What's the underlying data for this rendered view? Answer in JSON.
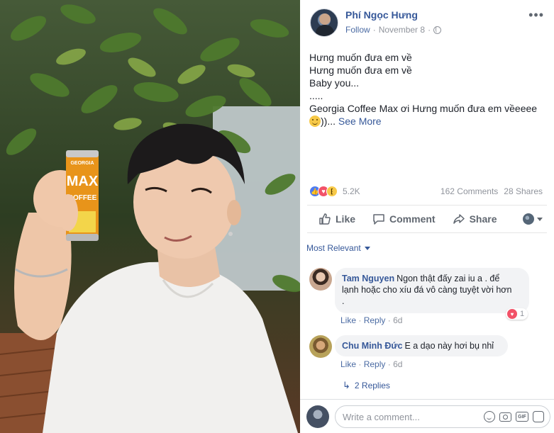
{
  "post": {
    "author": "Phí Ngọc Hưng",
    "follow": "Follow",
    "separator": "·",
    "date": "November 8",
    "separator2": "·",
    "more": "•••",
    "lines": [
      "Hưng muốn đưa em về",
      "Hưng muốn đưa em về",
      "Baby you...",
      ".....",
      "Georgia Coffee Max ơi Hưng muốn đưa em vềeeee"
    ],
    "last_line_suffix": "))...",
    "see_more": "See More"
  },
  "photo": {
    "can_brand": "GEORGIA",
    "can_line1": "MAX",
    "can_line2": "COFFEE"
  },
  "stats": {
    "reaction_count": "5.2K",
    "comments": "162 Comments",
    "shares": "28 Shares"
  },
  "actions": {
    "like": "Like",
    "comment": "Comment",
    "share": "Share"
  },
  "sort_label": "Most Relevant",
  "comments": [
    {
      "name": "Tam Nguyen",
      "line1": "Ngon thật đấy zai iu a . để",
      "line2": "lạnh hoặc cho xíu đá vô càng tuyệt vời hơn",
      "line3": ".",
      "like": "Like",
      "reply": "Reply",
      "time": "6d",
      "reaction_count": "1"
    },
    {
      "name": "Chu Minh Đức",
      "text": "E a dạo này hơi bụ nhỉ",
      "like": "Like",
      "reply": "Reply",
      "time": "6d"
    }
  ],
  "replies_label": "2 Replies",
  "composer": {
    "placeholder": "Write a comment...",
    "gif": "GIF"
  },
  "colors": {
    "link": "#365899",
    "like_blue": "#4c7bf3",
    "love_red": "#f25268",
    "haha_yellow": "#f7c948"
  }
}
